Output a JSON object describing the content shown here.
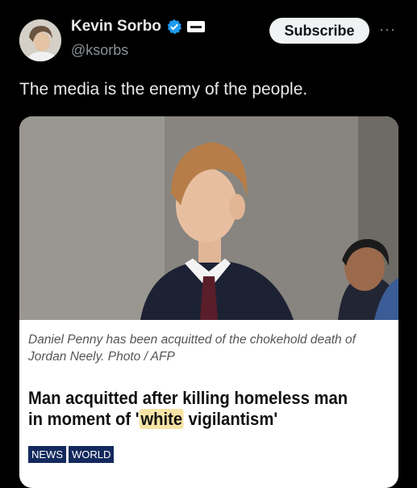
{
  "author": {
    "name": "Kevin Sorbo",
    "handle": "@ksorbs",
    "verified_icon": "verified-badge-icon",
    "affiliate_icon": "affiliation-badge-icon"
  },
  "actions": {
    "subscribe_label": "Subscribe",
    "more_label": "···"
  },
  "tweet": {
    "text": "The media is the enemy of the people."
  },
  "article": {
    "caption": "Daniel Penny has been acquitted of the chokehold death of Jordan Neely. Photo / AFP",
    "headline_before": "Man acquitted after killing homeless man in moment of '",
    "headline_highlight": "white",
    "headline_after": " vigilantism'",
    "tags": [
      "NEWS",
      "WORLD"
    ]
  },
  "colors": {
    "background": "#000000",
    "verified_blue": "#1d9bf0",
    "highlight": "#f6e4a6",
    "tag_navy": "#142a5e"
  }
}
